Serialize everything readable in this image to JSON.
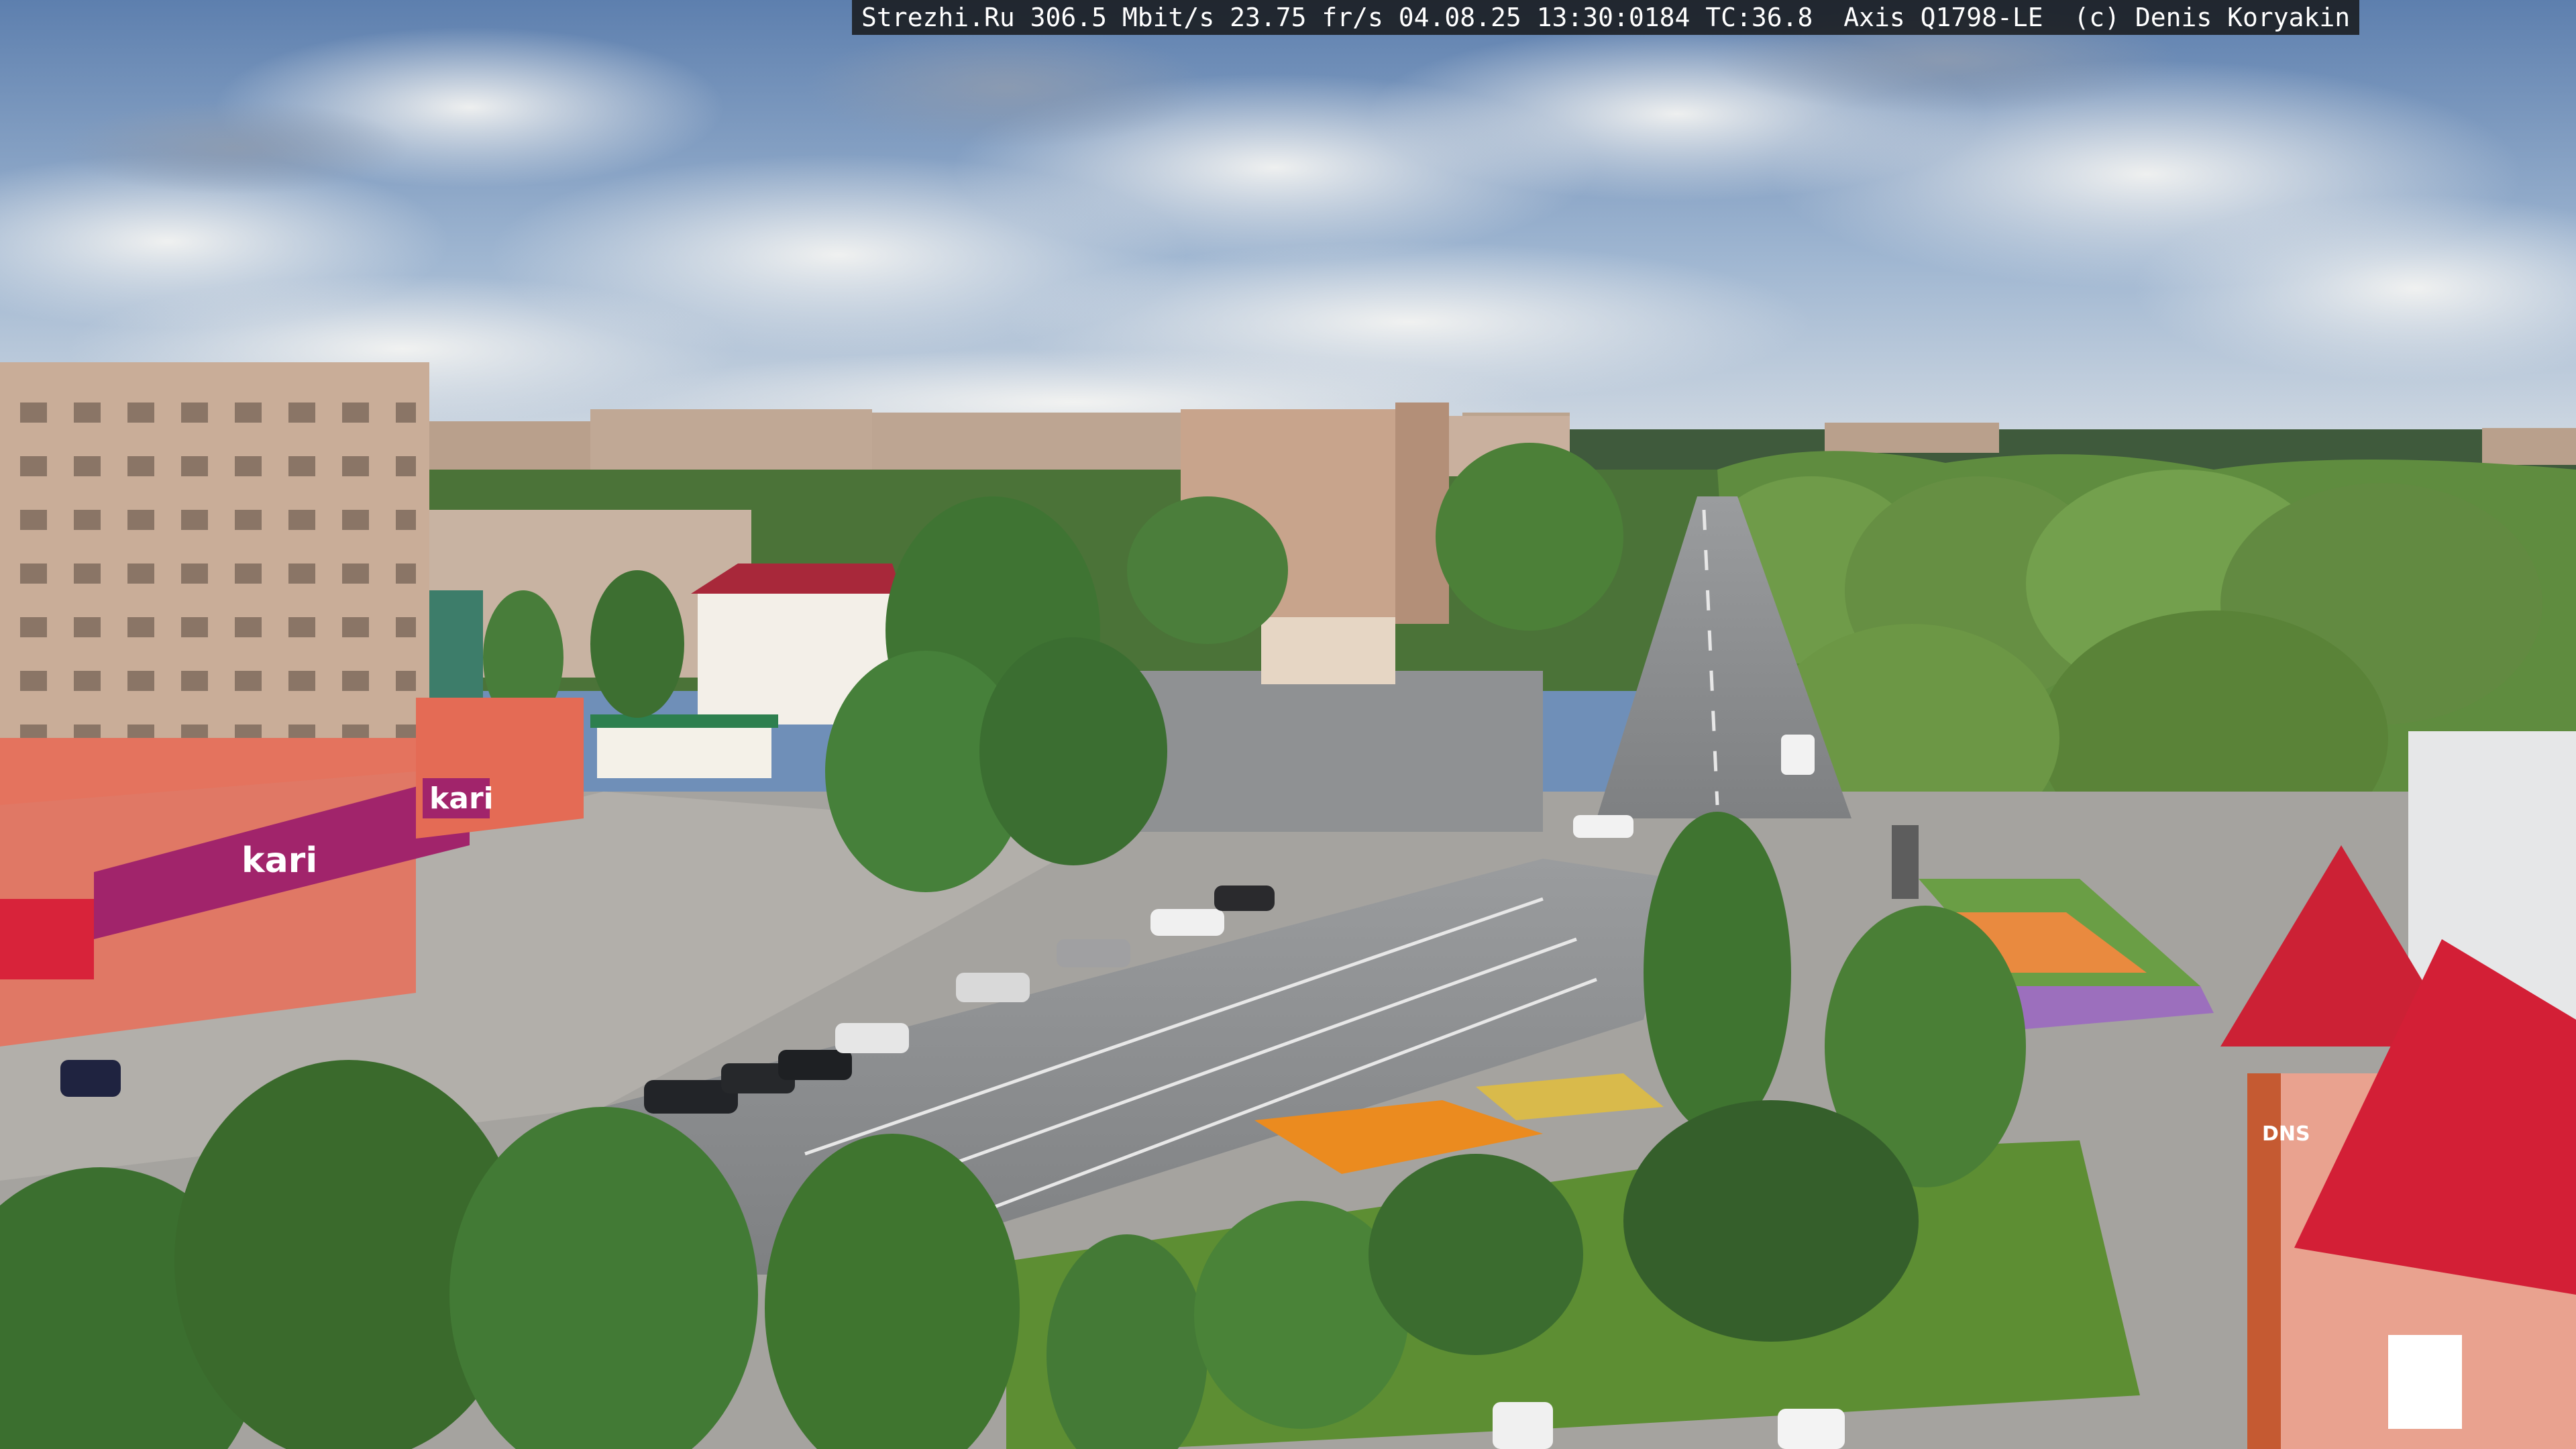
{
  "overlay": {
    "info": "Strezhi.Ru 306.5 Mbit/s 23.75 fr/s 04.08.25 13:30:0184 TC:36.8  Axis Q1798-LE ",
    "copyright": " (c) Denis Koryakin"
  },
  "signs": {
    "store_left": "kari",
    "store_small": "kari",
    "store_right": "DNS"
  }
}
